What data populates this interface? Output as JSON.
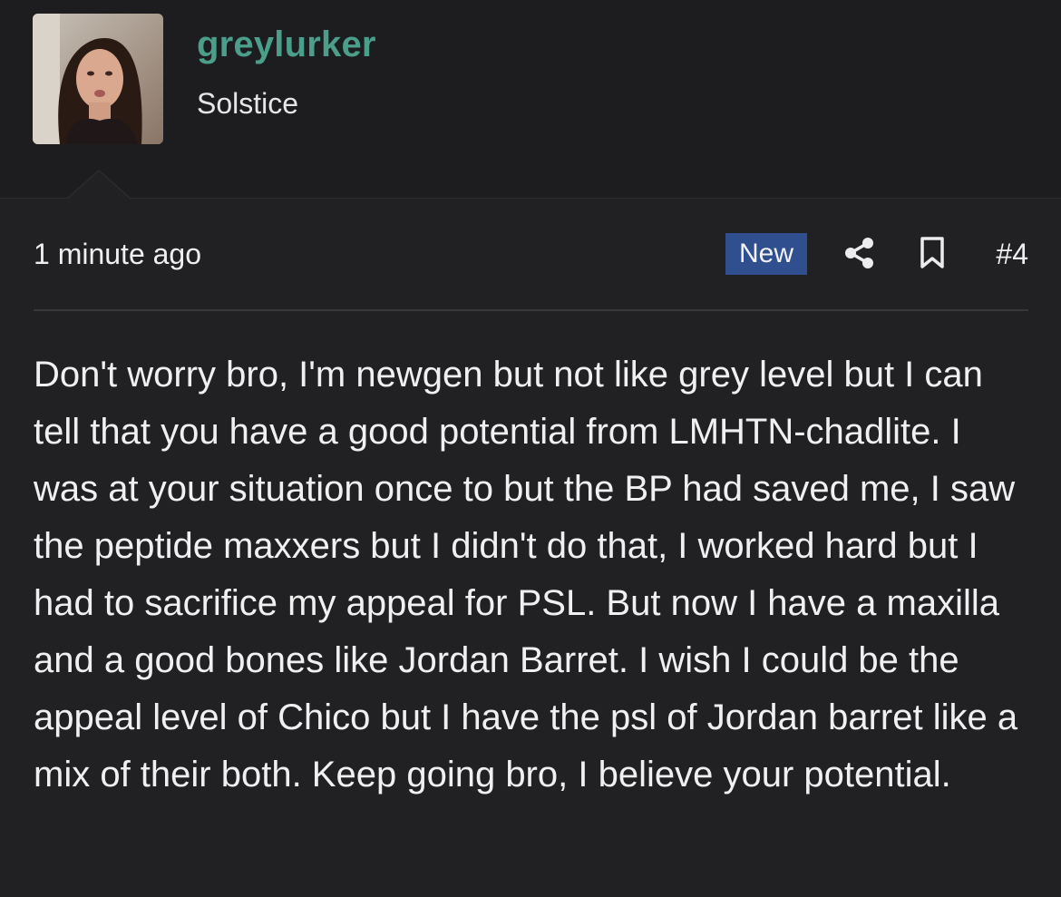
{
  "author": {
    "username": "greylurker",
    "user_title": "Solstice",
    "avatar_icon": "avatar-photo"
  },
  "post": {
    "timestamp": "1 minute ago",
    "badge": "New",
    "post_number": "#4",
    "share_icon": "share-icon",
    "bookmark_icon": "bookmark-icon",
    "body": "Don't worry bro, I'm newgen but not like grey level but I can tell that you have a good potential from LMHTN-chadlite. I was at your situation once to but the BP had saved me, I saw the peptide maxxers but I didn't do that, I worked hard but I had to sacrifice my appeal for PSL. But now I have a maxilla and a good bones like Jordan Barret. I wish I could be the appeal level of Chico but I have the psl of Jordan barret like a mix of their both. Keep going bro, I believe your potential."
  },
  "colors": {
    "background": "#212124",
    "header_background": "#1d1d20",
    "username": "#4a9e8a",
    "badge": "#2f4f8f",
    "text": "#f0f0f0"
  }
}
